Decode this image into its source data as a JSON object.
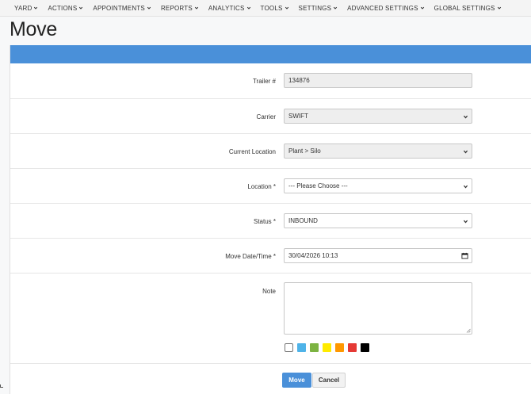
{
  "nav": {
    "items": [
      {
        "label": "YARD",
        "icon": "chevron-down-icon"
      },
      {
        "label": "ACTIONS",
        "icon": "chevron-down-icon"
      },
      {
        "label": "APPOINTMENTS",
        "icon": "chevron-down-icon"
      },
      {
        "label": "REPORTS",
        "icon": "chevron-down-icon"
      },
      {
        "label": "ANALYTICS",
        "icon": "chevron-down-icon"
      },
      {
        "label": "TOOLS",
        "icon": "chevron-down-icon"
      },
      {
        "label": "SETTINGS",
        "icon": "chevron-down-icon"
      },
      {
        "label": "ADVANCED SETTINGS",
        "icon": "chevron-down-icon"
      },
      {
        "label": "GLOBAL SETTINGS",
        "icon": "chevron-down-icon"
      }
    ]
  },
  "page": {
    "title": "Move"
  },
  "form": {
    "trailer_label": "Trailer #",
    "trailer_value": "134876",
    "carrier_label": "Carrier",
    "carrier_value": "SWIFT",
    "current_location_label": "Current Location",
    "current_location_value": "Plant > Silo",
    "location_label": "Location *",
    "location_value": "--- Please Choose ---",
    "status_label": "Status *",
    "status_value": "INBOUND",
    "move_datetime_label": "Move Date/Time *",
    "move_datetime_value": "30/04/2026 10:13",
    "note_label": "Note",
    "note_value": "",
    "colors": [
      "#ffffff",
      "#4fb3e8",
      "#7cb342",
      "#ffeb00",
      "#ff9800",
      "#e53935",
      "#000000"
    ],
    "move_button": "Move",
    "cancel_button": "Cancel"
  },
  "theme": {
    "accent": "#4a90d9"
  }
}
